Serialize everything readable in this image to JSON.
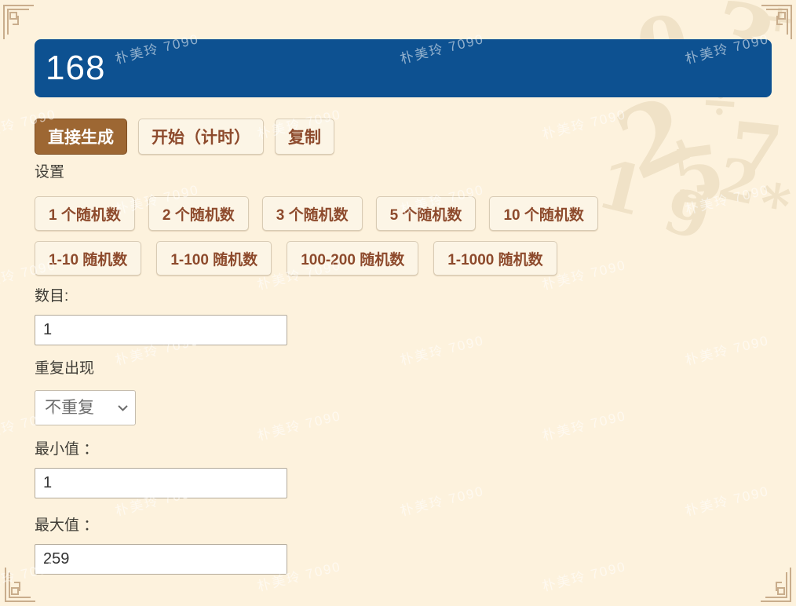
{
  "result": {
    "value": "168"
  },
  "actions": {
    "generate": "直接生成",
    "start_timer": "开始（计时）",
    "copy": "复制"
  },
  "settings": {
    "title": "设置",
    "presets_row1": [
      "1 个随机数",
      "2 个随机数",
      "3 个随机数",
      "5 个随机数",
      "10 个随机数"
    ],
    "presets_row2": [
      "1-10 随机数",
      "1-100 随机数",
      "100-200 随机数",
      "1-1000 随机数"
    ]
  },
  "fields": {
    "count": {
      "label": "数目:",
      "value": "1"
    },
    "repeat": {
      "label": "重复出现",
      "value": "不重复"
    },
    "min": {
      "label": "最小值 ：",
      "value": "1"
    },
    "max": {
      "label": "最大值 ：",
      "value": "259"
    }
  },
  "watermark": {
    "text": "朴美玲 7090"
  },
  "background_art": {
    "glyphs": [
      "2",
      "1",
      "5",
      "2",
      "7",
      "9",
      "3",
      "÷",
      "*",
      "+",
      "-",
      "0"
    ]
  },
  "colors": {
    "accent_blue": "#0d5191",
    "accent_brown": "#9d6733",
    "page_background": "#fdf2dd",
    "button_text_brown": "#8d4a2c"
  }
}
